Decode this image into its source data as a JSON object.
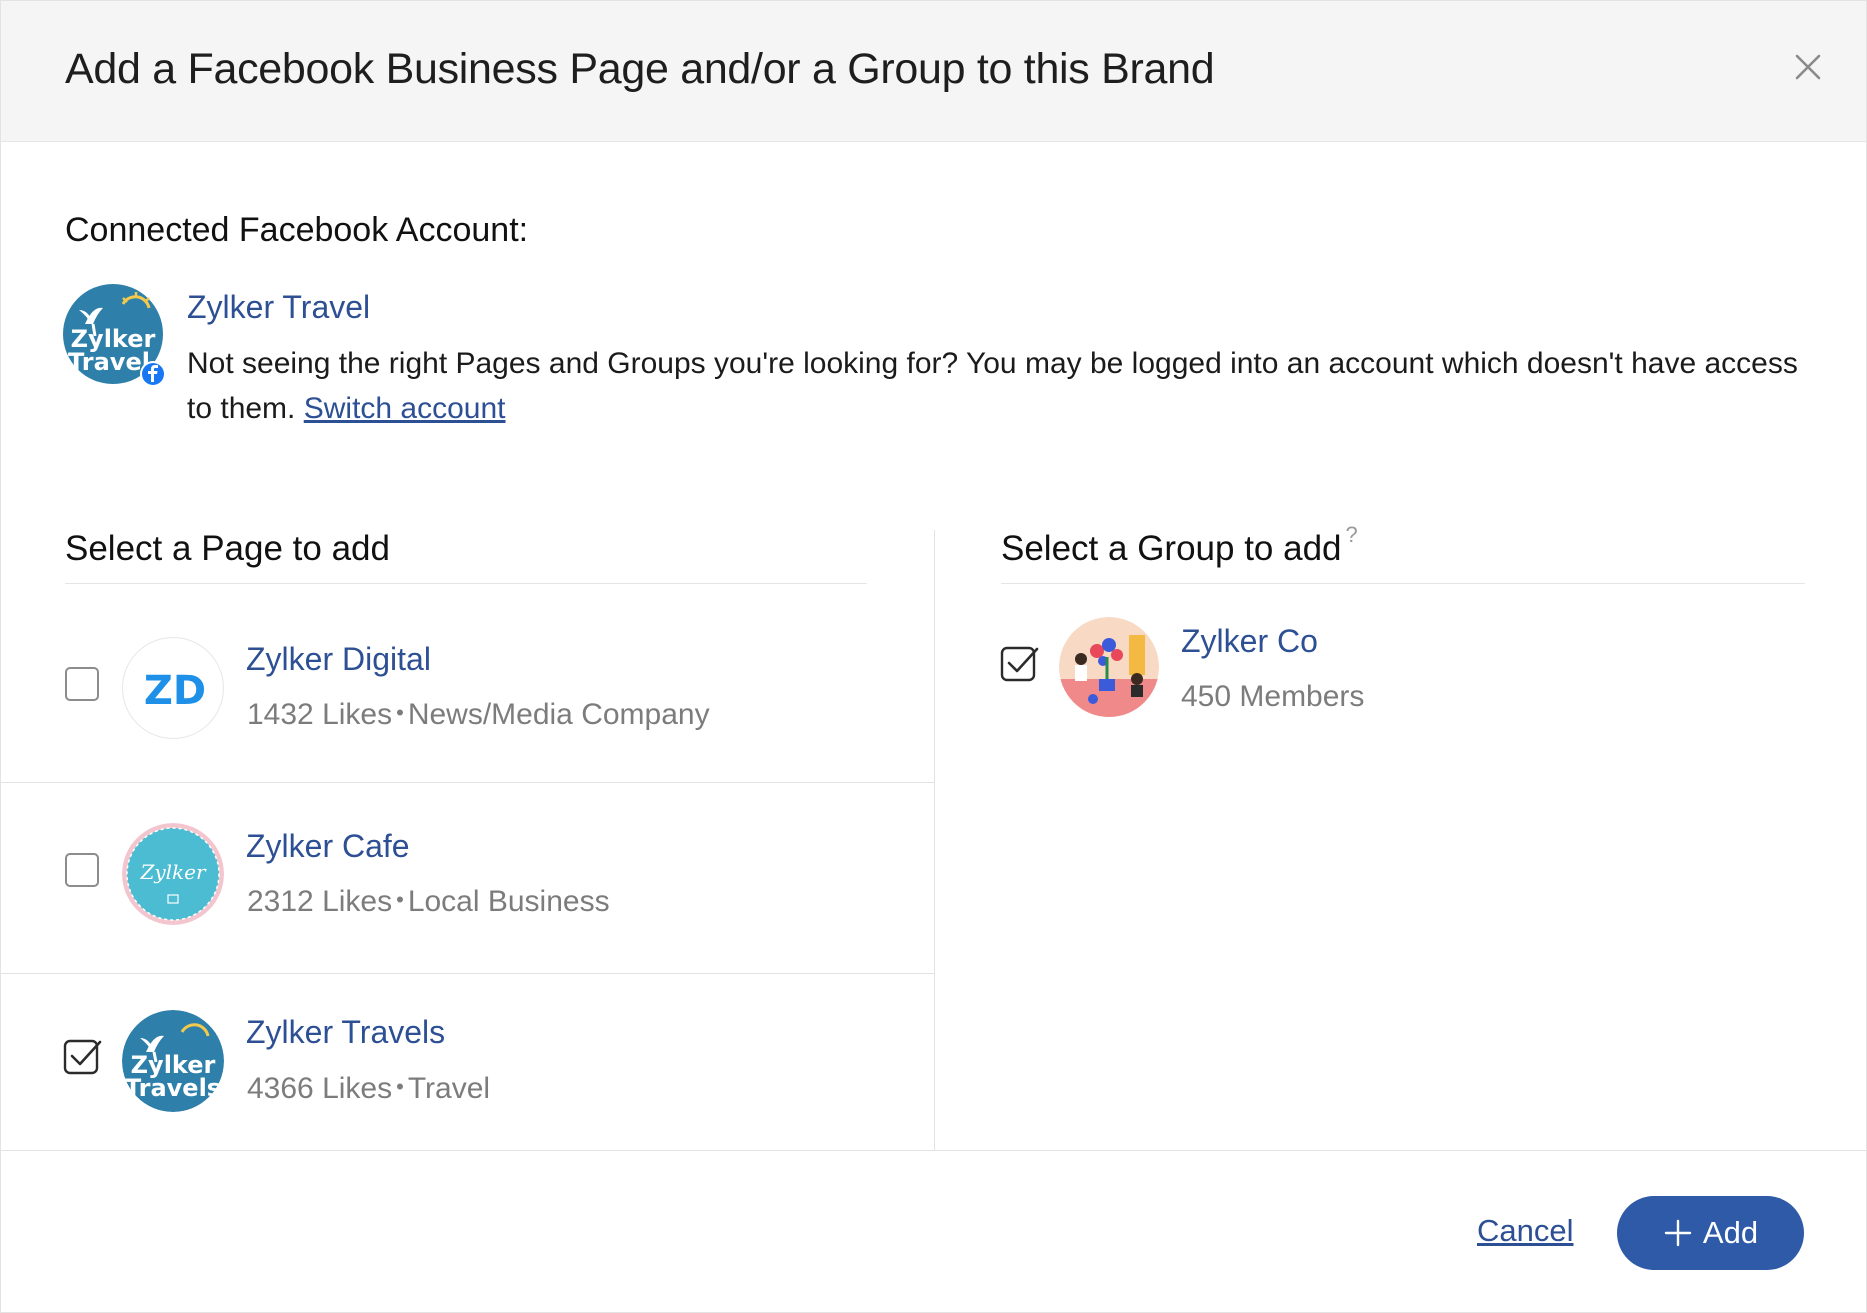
{
  "dialog": {
    "title": "Add a Facebook Business Page and/or a Group to this Brand"
  },
  "account": {
    "section_label": "Connected Facebook Account:",
    "name": "Zylker Travel",
    "avatar_text_line1": "Zylker",
    "avatar_text_line2": "Travel",
    "note": "Not seeing the right Pages and Groups you're looking for? You may be logged into an account which doesn't have access to them.",
    "switch_label": "Switch account"
  },
  "pages": {
    "title": "Select a Page to add",
    "items": [
      {
        "name": "Zylker Digital",
        "likes": "1432 Likes",
        "category": "News/Media Company",
        "checked": false,
        "avatar_text": "ZD"
      },
      {
        "name": "Zylker Cafe",
        "likes": "2312 Likes",
        "category": "Local Business",
        "checked": false,
        "avatar_text": "Zylker"
      },
      {
        "name": "Zylker Travels",
        "likes": "4366 Likes",
        "category": "Travel",
        "checked": true,
        "avatar_text_line1": "Zylker",
        "avatar_text_line2": "Travels"
      }
    ]
  },
  "groups": {
    "title": "Select a Group to add",
    "help": "?",
    "items": [
      {
        "name": "Zylker Co",
        "members": "450  Members",
        "checked": true
      }
    ]
  },
  "footer": {
    "cancel_label": "Cancel",
    "add_label": "Add"
  },
  "colors": {
    "link": "#2d4f94",
    "primary_button": "#2f5aa7",
    "header_bg": "#f5f5f5",
    "facebook_blue": "#1877f2"
  },
  "icons": {
    "close": "close-icon",
    "checkbox_checked": "checkbox-checked-icon",
    "facebook_badge": "facebook-icon",
    "add": "plus-icon",
    "help": "help-icon"
  }
}
